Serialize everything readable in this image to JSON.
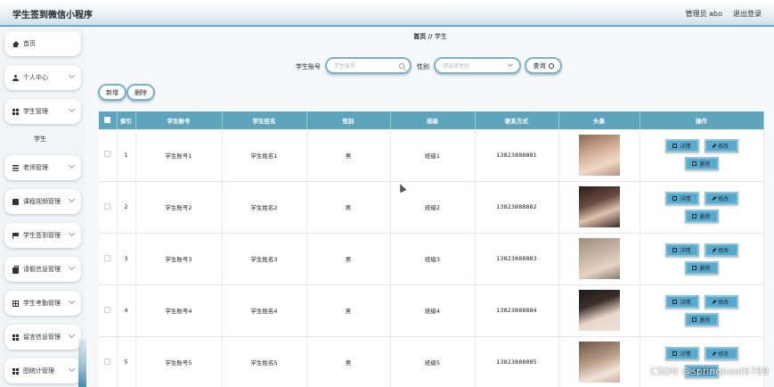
{
  "app": {
    "title": "学生签到微信小程序"
  },
  "header": {
    "admin": "管理员 abo",
    "logout": "退出登录"
  },
  "sidebar": {
    "items": [
      {
        "label": "首页",
        "icon": "home-icon",
        "has_chevron": false
      },
      {
        "label": "个人中心",
        "icon": "user-icon",
        "has_chevron": true
      },
      {
        "label": "学生管理",
        "icon": "grid-icon",
        "has_chevron": true,
        "expanded": true,
        "children": [
          "学生"
        ]
      },
      {
        "label": "老师管理",
        "icon": "list-icon",
        "has_chevron": true
      },
      {
        "label": "课程视频管理",
        "icon": "card-icon",
        "has_chevron": true
      },
      {
        "label": "学生签到管理",
        "icon": "flag-icon",
        "has_chevron": true
      },
      {
        "label": "请假信息管理",
        "icon": "bag-icon",
        "has_chevron": true
      },
      {
        "label": "学生考勤管理",
        "icon": "table-icon",
        "has_chevron": true
      },
      {
        "label": "留言信息管理",
        "icon": "grid-icon",
        "has_chevron": true
      },
      {
        "label": "图统计管理",
        "icon": "grid-icon",
        "has_chevron": true
      }
    ]
  },
  "breadcrumb": {
    "home": "首页",
    "sep": "//",
    "current": "学生"
  },
  "search": {
    "account_label": "学生账号",
    "account_placeholder": "学生账号",
    "gender_label": "性别",
    "gender_placeholder": "请选择性别",
    "query_button": "查询"
  },
  "actions": {
    "add": "新增",
    "delete": "删除"
  },
  "table": {
    "columns": [
      "索引",
      "学生账号",
      "学生姓名",
      "性别",
      "班级",
      "联系方式",
      "头像",
      "操作"
    ],
    "rows": [
      {
        "index": "1",
        "account": "学生账号1",
        "name": "学生姓名1",
        "gender": "男",
        "class": "班级1",
        "phone": "13823888881"
      },
      {
        "index": "2",
        "account": "学生账号2",
        "name": "学生姓名2",
        "gender": "男",
        "class": "班级2",
        "phone": "13823888882"
      },
      {
        "index": "3",
        "account": "学生账号3",
        "name": "学生姓名3",
        "gender": "男",
        "class": "班级3",
        "phone": "13823888883"
      },
      {
        "index": "4",
        "account": "学生账号4",
        "name": "学生姓名4",
        "gender": "男",
        "class": "班级4",
        "phone": "13823888884"
      },
      {
        "index": "5",
        "account": "学生账号5",
        "name": "学生姓名5",
        "gender": "男",
        "class": "班级5",
        "phone": "13823888885"
      }
    ],
    "ops": {
      "detail": "详情",
      "edit": "修改",
      "delete": "删除"
    }
  },
  "watermark": "CSDN @springboot6789",
  "colors": {
    "accent": "#5fa4bd",
    "button": "#59a9cc",
    "border": "#7fb0c6"
  }
}
